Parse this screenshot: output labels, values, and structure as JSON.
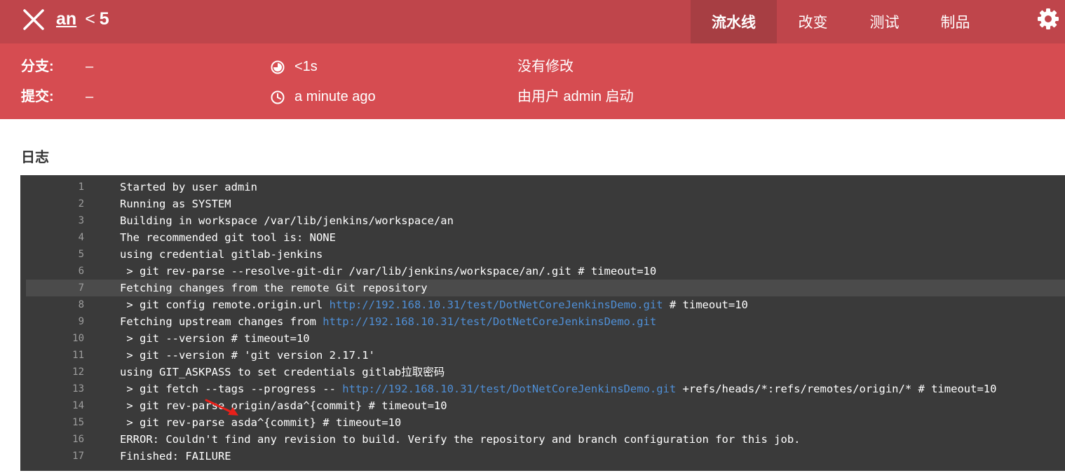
{
  "header": {
    "job_name": "an",
    "separator": "<",
    "build_number": "5",
    "tabs": [
      {
        "label": "流水线",
        "active": true
      },
      {
        "label": "改变",
        "active": false
      },
      {
        "label": "测试",
        "active": false
      },
      {
        "label": "制品",
        "active": false
      }
    ]
  },
  "info": {
    "branch_label": "分支:",
    "branch_value": "–",
    "commit_label": "提交:",
    "commit_value": "–",
    "duration": "<1s",
    "time_ago": "a minute ago",
    "changes": "没有修改",
    "started_by": "由用户 admin 启动"
  },
  "log": {
    "heading": "日志",
    "highlighted_line": 7,
    "lines": [
      {
        "num": "1",
        "parts": [
          {
            "t": "Started by user admin"
          }
        ]
      },
      {
        "num": "2",
        "parts": [
          {
            "t": "Running as SYSTEM"
          }
        ]
      },
      {
        "num": "3",
        "parts": [
          {
            "t": "Building in workspace /var/lib/jenkins/workspace/an"
          }
        ]
      },
      {
        "num": "4",
        "parts": [
          {
            "t": "The recommended git tool is: NONE"
          }
        ]
      },
      {
        "num": "5",
        "parts": [
          {
            "t": "using credential gitlab-jenkins"
          }
        ]
      },
      {
        "num": "6",
        "parts": [
          {
            "t": " > git rev-parse --resolve-git-dir /var/lib/jenkins/workspace/an/.git # timeout=10"
          }
        ]
      },
      {
        "num": "7",
        "parts": [
          {
            "t": "Fetching changes from the remote Git repository"
          }
        ]
      },
      {
        "num": "8",
        "parts": [
          {
            "t": " > git config remote.origin.url "
          },
          {
            "t": "http://192.168.10.31/test/DotNetCoreJenkinsDemo.git",
            "link": true
          },
          {
            "t": " # timeout=10"
          }
        ]
      },
      {
        "num": "9",
        "parts": [
          {
            "t": "Fetching upstream changes from "
          },
          {
            "t": "http://192.168.10.31/test/DotNetCoreJenkinsDemo.git",
            "link": true
          }
        ]
      },
      {
        "num": "10",
        "parts": [
          {
            "t": " > git --version # timeout=10"
          }
        ]
      },
      {
        "num": "11",
        "parts": [
          {
            "t": " > git --version # 'git version 2.17.1'"
          }
        ]
      },
      {
        "num": "12",
        "parts": [
          {
            "t": "using GIT_ASKPASS to set credentials gitlab拉取密码"
          }
        ]
      },
      {
        "num": "13",
        "parts": [
          {
            "t": " > git fetch --tags --progress -- "
          },
          {
            "t": "http://192.168.10.31/test/DotNetCoreJenkinsDemo.git",
            "link": true
          },
          {
            "t": " +refs/heads/*:refs/remotes/origin/* # timeout=10"
          }
        ]
      },
      {
        "num": "14",
        "parts": [
          {
            "t": " > git rev-parse origin/asda^{commit} # timeout=10"
          }
        ]
      },
      {
        "num": "15",
        "parts": [
          {
            "t": " > git rev-parse asda^{commit} # timeout=10"
          }
        ]
      },
      {
        "num": "16",
        "parts": [
          {
            "t": "ERROR: Couldn't find any revision to build. Verify the repository and branch configuration for this job."
          }
        ]
      },
      {
        "num": "17",
        "parts": [
          {
            "t": "Finished: FAILURE"
          }
        ]
      }
    ]
  },
  "colors": {
    "header_bg": "#bf454b",
    "active_tab_bg": "#a73e43",
    "infobar_bg": "#d64c51",
    "console_bg": "#3a3a3a",
    "link": "#4f8fd6",
    "annotation_arrow": "#e8201a"
  },
  "icons": {
    "close": "close-icon",
    "settings": "gear-icon",
    "duration": "duration-clock-icon",
    "time": "clock-icon"
  }
}
